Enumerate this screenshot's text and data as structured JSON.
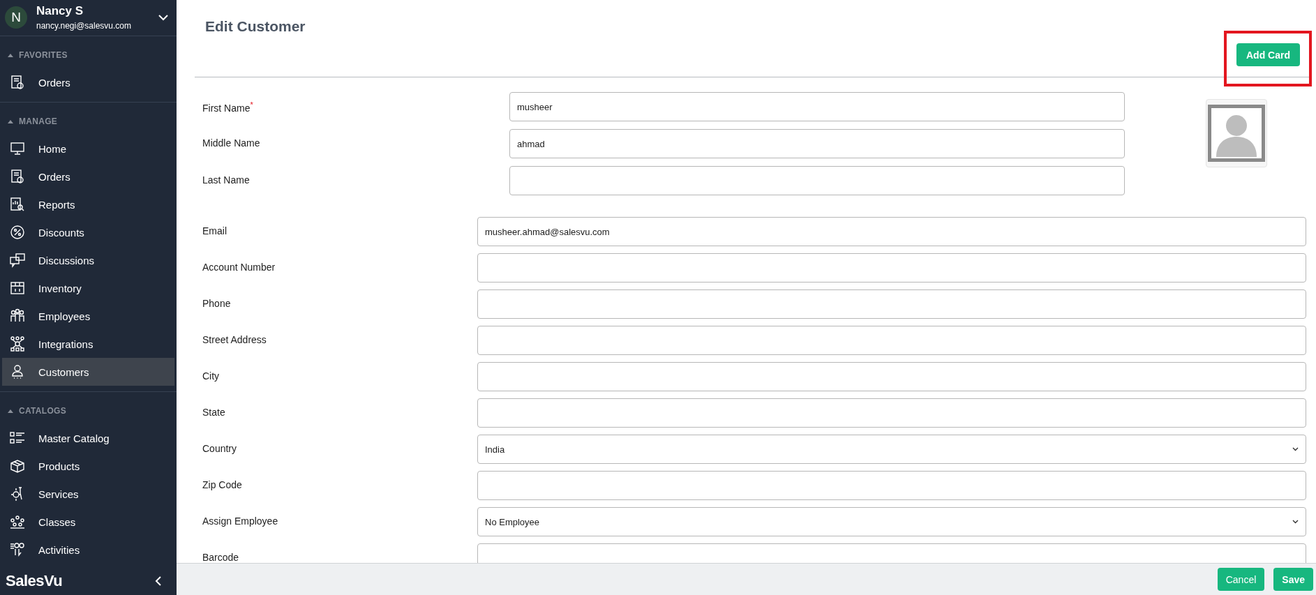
{
  "user": {
    "initial": "N",
    "name": "Nancy S",
    "email": "nancy.negi@salesvu.com"
  },
  "sidebar": {
    "sections": [
      {
        "title": "FAVORITES",
        "items": [
          {
            "label": "Orders",
            "selected": false
          }
        ]
      },
      {
        "title": "MANAGE",
        "items": [
          {
            "label": "Home",
            "selected": false
          },
          {
            "label": "Orders",
            "selected": false
          },
          {
            "label": "Reports",
            "selected": false
          },
          {
            "label": "Discounts",
            "selected": false
          },
          {
            "label": "Discussions",
            "selected": false
          },
          {
            "label": "Inventory",
            "selected": false
          },
          {
            "label": "Employees",
            "selected": false
          },
          {
            "label": "Integrations",
            "selected": false
          },
          {
            "label": "Customers",
            "selected": true
          }
        ]
      },
      {
        "title": "CATALOGS",
        "items": [
          {
            "label": "Master Catalog",
            "selected": false
          },
          {
            "label": "Products",
            "selected": false
          },
          {
            "label": "Services",
            "selected": false
          },
          {
            "label": "Classes",
            "selected": false
          },
          {
            "label": "Activities",
            "selected": false
          }
        ]
      }
    ],
    "logo": "SalesVu"
  },
  "page": {
    "title": "Edit Customer",
    "add_card": {
      "label": "Add Card",
      "highlighted": true
    }
  },
  "name_fields": [
    {
      "label": "First Name",
      "marker": "*",
      "value": "musheer"
    },
    {
      "label": "Middle Name",
      "value": "ahmad"
    },
    {
      "label": "Last Name"
    }
  ],
  "fields": [
    {
      "label": "Email",
      "kind": "text",
      "value": "musheer.ahmad@salesvu.com"
    },
    {
      "label": "Account Number",
      "kind": "text"
    },
    {
      "label": "Phone",
      "kind": "text"
    },
    {
      "label": "Street Address",
      "kind": "text"
    },
    {
      "label": "City",
      "kind": "text"
    },
    {
      "label": "State",
      "kind": "text"
    },
    {
      "label": "Country",
      "kind": "select",
      "value": "India"
    },
    {
      "label": "Zip Code",
      "kind": "text"
    },
    {
      "label": "Assign Employee",
      "kind": "select",
      "value": "No Employee"
    },
    {
      "label": "Barcode",
      "kind": "text"
    }
  ],
  "footer": {
    "buttons": [
      "Cancel",
      "Save"
    ]
  }
}
